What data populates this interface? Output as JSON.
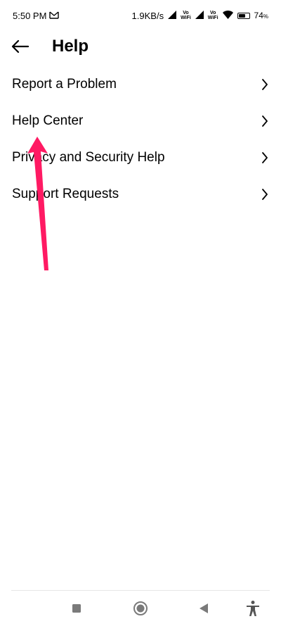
{
  "status_bar": {
    "time": "5:50 PM",
    "network_speed": "1.9KB/s",
    "vowifi_top": "Vo",
    "vowifi_bottom": "WiFi",
    "battery_percent": "74",
    "battery_suffix": "%",
    "battery_level": 0.74,
    "icons": [
      "gmail-icon",
      "signal-icon",
      "vowifi-icon",
      "wifi-icon",
      "battery-icon"
    ]
  },
  "header": {
    "title": "Help",
    "back_icon": "arrow-left-icon"
  },
  "menu": {
    "items": [
      {
        "label": "Report a Problem"
      },
      {
        "label": "Help Center"
      },
      {
        "label": "Privacy and Security Help"
      },
      {
        "label": "Support Requests"
      }
    ]
  },
  "annotation": {
    "arrow_color": "#ff1a63"
  },
  "nav_bar": {
    "icons": [
      "recents-square-icon",
      "home-circle-icon",
      "back-triangle-icon",
      "accessibility-icon"
    ]
  },
  "colors": {
    "background": "#ffffff",
    "text": "#000000",
    "nav_icon": "#7a7a7a"
  }
}
